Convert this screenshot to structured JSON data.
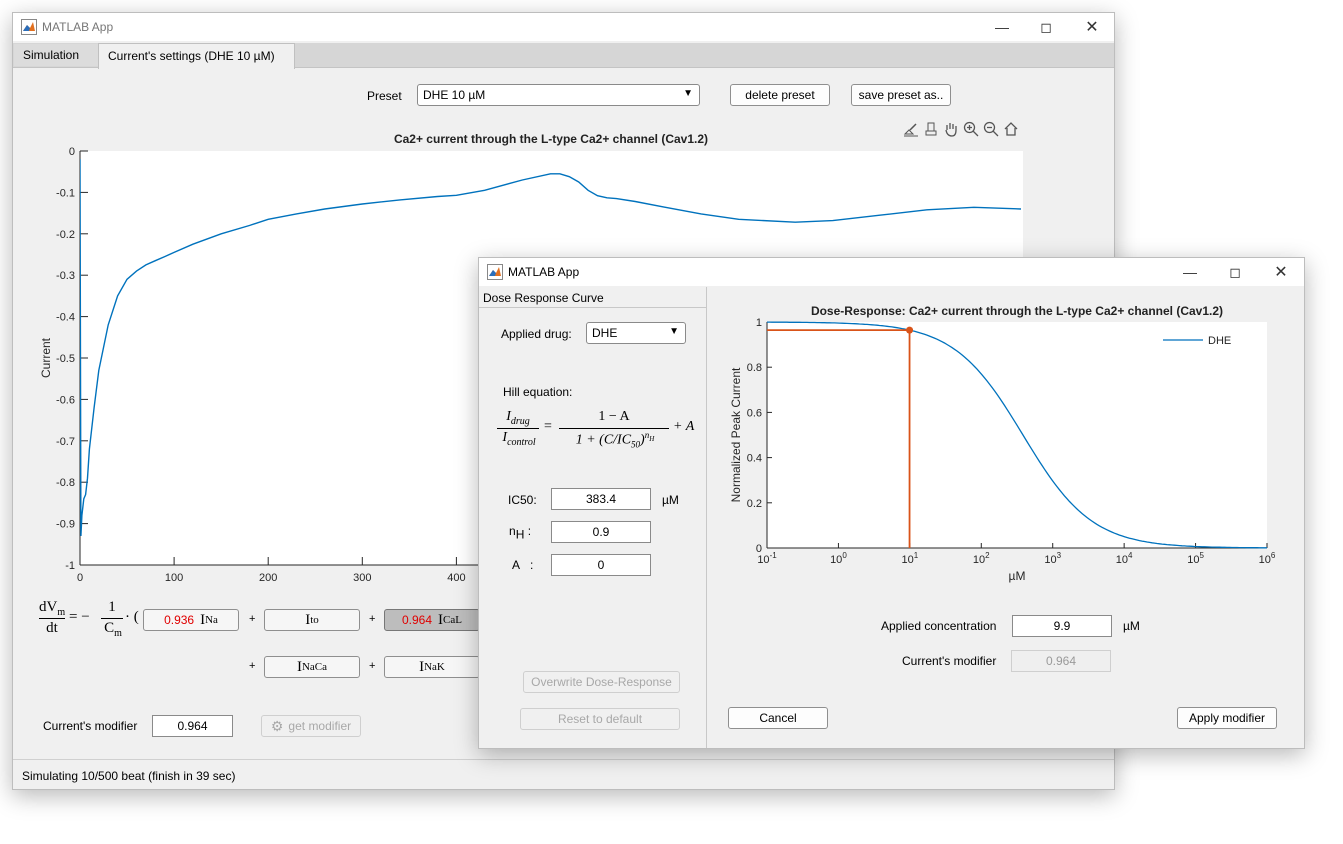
{
  "main_window": {
    "title": "MATLAB App",
    "tabs": [
      {
        "label": "Simulation",
        "active": false
      },
      {
        "label": "Current's settings (DHE 10 µM)",
        "active": true
      }
    ],
    "preset": {
      "label": "Preset",
      "value": "DHE 10 µM"
    },
    "delete_preset": "delete preset",
    "save_preset": "save preset as..",
    "toolbar_icons": [
      "brush-icon",
      "data-tip-icon",
      "pan-hand-icon",
      "zoom-in-icon",
      "zoom-out-icon",
      "home-icon"
    ],
    "equation": {
      "lhs_num": "dV",
      "lhs_num_sub": "m",
      "lhs_den": "dt",
      "rhs_prefix": "= −",
      "frac_num": "1",
      "frac_den": "C",
      "frac_den_sub": "m",
      "dot_paren": "· (",
      "terms": [
        {
          "coef": "0.936",
          "symbol": "I",
          "sub": "Na",
          "selected": false
        },
        {
          "coef": "",
          "symbol": "I",
          "sub": "to",
          "selected": false
        },
        {
          "coef": "0.964",
          "symbol": "I",
          "sub": "CaL",
          "selected": true
        },
        {
          "coef": "",
          "symbol": "I",
          "sub": "NaCa",
          "selected": false
        },
        {
          "coef": "",
          "symbol": "I",
          "sub": "NaK",
          "selected": false
        }
      ],
      "plus": "+"
    },
    "modifier": {
      "label": "Current's modifier",
      "value": "0.964"
    },
    "get_modifier": "get modifier",
    "status": "Simulating 10/500 beat (finish in 39 sec)"
  },
  "chart_data": [
    {
      "type": "line",
      "title": "Ca2+ current through the L-type Ca2+ channel (Cav1.2)",
      "xlabel": "",
      "ylabel": "Current",
      "xlim": [
        0,
        400
      ],
      "ylim": [
        -1,
        0
      ],
      "xticks": [
        "0",
        "100",
        "200",
        "300",
        "400"
      ],
      "yticks": [
        "0",
        "-0.1",
        "-0.2",
        "-0.3",
        "-0.4",
        "-0.5",
        "-0.6",
        "-0.7",
        "-0.8",
        "-0.9",
        "-1"
      ],
      "x": [
        0,
        1,
        2,
        4,
        6,
        8,
        10,
        15,
        20,
        30,
        40,
        50,
        60,
        70,
        80,
        90,
        100,
        120,
        150,
        180,
        200,
        230,
        260,
        300,
        340,
        380,
        400,
        430,
        470,
        500,
        510,
        520,
        530,
        540,
        550,
        560,
        570,
        590,
        620,
        660,
        700,
        760,
        800,
        850,
        900,
        950,
        1000
      ],
      "y": [
        -0.02,
        -0.93,
        -0.88,
        -0.84,
        -0.83,
        -0.79,
        -0.72,
        -0.62,
        -0.53,
        -0.42,
        -0.35,
        -0.31,
        -0.29,
        -0.275,
        -0.265,
        -0.255,
        -0.245,
        -0.225,
        -0.2,
        -0.18,
        -0.165,
        -0.152,
        -0.14,
        -0.128,
        -0.118,
        -0.11,
        -0.107,
        -0.095,
        -0.07,
        -0.055,
        -0.055,
        -0.062,
        -0.075,
        -0.095,
        -0.108,
        -0.113,
        -0.115,
        -0.122,
        -0.135,
        -0.152,
        -0.165,
        -0.172,
        -0.168,
        -0.155,
        -0.142,
        -0.136,
        -0.14
      ],
      "series": [
        {
          "name": "",
          "color": "#0072BD"
        }
      ]
    },
    {
      "type": "line",
      "title": "Dose-Response: Ca2+ current through the L-type Ca2+ channel (Cav1.2)",
      "xlabel": "µM",
      "ylabel": "Normalized Peak Current",
      "xscale": "log",
      "xlim": [
        0.1,
        1000000
      ],
      "ylim": [
        0,
        1
      ],
      "xticks": [
        "10",
        "10",
        "10",
        "10",
        "10",
        "10",
        "10",
        "10"
      ],
      "xtick_exponents": [
        "-1",
        "0",
        "1",
        "2",
        "3",
        "4",
        "5",
        "6"
      ],
      "yticks": [
        "0",
        "0.2",
        "0.4",
        "0.6",
        "0.8",
        "1"
      ],
      "series": [
        {
          "name": "DHE",
          "color": "#0072BD",
          "ic50": 383.4,
          "nh": 0.9,
          "A": 0
        }
      ],
      "marker": {
        "x": 9.9,
        "y": 0.964,
        "color": "#D95319"
      },
      "legend": "top-right"
    }
  ],
  "dialog": {
    "title": "MATLAB App",
    "panel_title": "Dose Response Curve",
    "applied_drug": {
      "label": "Applied drug:",
      "value": "DHE"
    },
    "hill_label": "Hill equation:",
    "hill": {
      "lhs_num": "I",
      "lhs_num_sub": "drug",
      "lhs_den": "I",
      "lhs_den_sub": "control",
      "eq": "=",
      "rhs_num": "1 − A",
      "rhs_den_a": "1 + (C/IC",
      "rhs_den_sub": "50",
      "rhs_den_b": ")",
      "rhs_den_sup": "n",
      "rhs_den_sup_sub": "H",
      "plus_a": "+ A"
    },
    "ic50": {
      "label": "IC50:",
      "value": "383.4",
      "unit": "µM"
    },
    "nh": {
      "label": "n",
      "label_sub": "H",
      "colon": ":",
      "value": "0.9"
    },
    "a": {
      "label": "A",
      "colon": ":",
      "value": "0"
    },
    "overwrite": "Overwrite Dose-Response",
    "reset": "Reset to default",
    "applied_conc": {
      "label": "Applied concentration",
      "value": "9.9",
      "unit": "µM"
    },
    "modifier": {
      "label": "Current's modifier",
      "value": "0.964"
    },
    "cancel": "Cancel",
    "apply": "Apply modifier"
  }
}
